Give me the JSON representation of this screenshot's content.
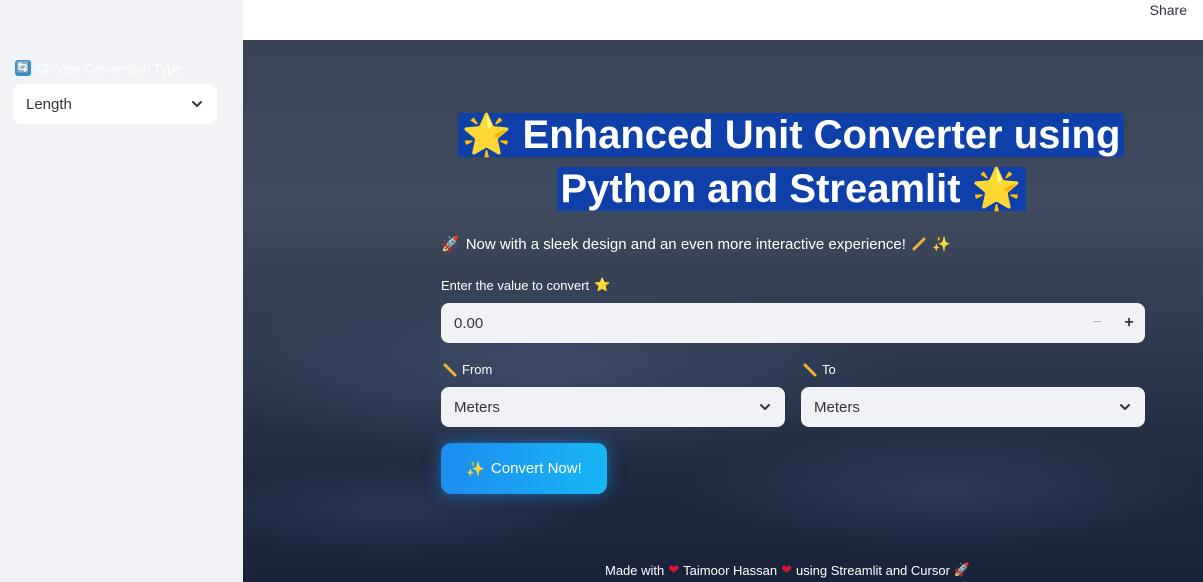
{
  "sidebar": {
    "label": "Choose Conversion Type",
    "label_icon": "🔄",
    "select_value": "Length"
  },
  "header": {
    "share_label": "Share"
  },
  "main": {
    "title_line1": "Enhanced Unit Converter using",
    "title_line2": "Python and Streamlit",
    "title_emoji": "🌟",
    "subtitle": "Now with a sleek design and an even more interactive experience!",
    "subtitle_start_emoji": "🚀",
    "subtitle_end_emoji": "✨",
    "input_label": "Enter the value to convert",
    "input_label_emoji": "⭐",
    "input_value": "0.00",
    "from_label": "From",
    "to_label": "To",
    "from_value": "Meters",
    "to_value": "Meters",
    "convert_label": "Convert Now!",
    "convert_emoji": "✨"
  },
  "footer": {
    "prefix": "Made with",
    "author": "Taimoor Hassan",
    "suffix": "using Streamlit and Cursor",
    "heart": "❤",
    "rocket": "🚀"
  },
  "colors": {
    "title_highlight": "#0f3fa8",
    "button_start": "#1e8cf0",
    "button_end": "#16b6f5",
    "heart": "#e0142c"
  }
}
